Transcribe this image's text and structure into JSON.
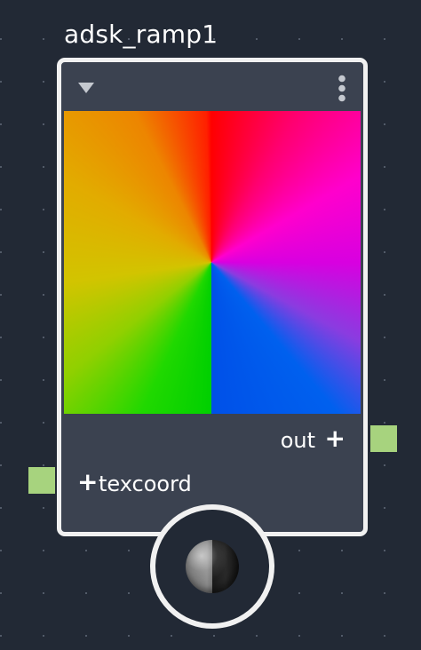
{
  "node": {
    "title": "adsk_ramp1",
    "outputs": [
      {
        "label": "out",
        "port_color": "#a7d37e"
      }
    ],
    "inputs": [
      {
        "label": "texcoord",
        "port_color": "#a7d37e"
      }
    ],
    "header_icons": {
      "collapse": "triangle-down-icon",
      "menu": "vertical-ellipsis-icon"
    },
    "preview": "color-wheel-swatch",
    "colors": {
      "canvas": "#222935",
      "node_body": "#3b4250",
      "border": "#f1f1f1"
    }
  }
}
